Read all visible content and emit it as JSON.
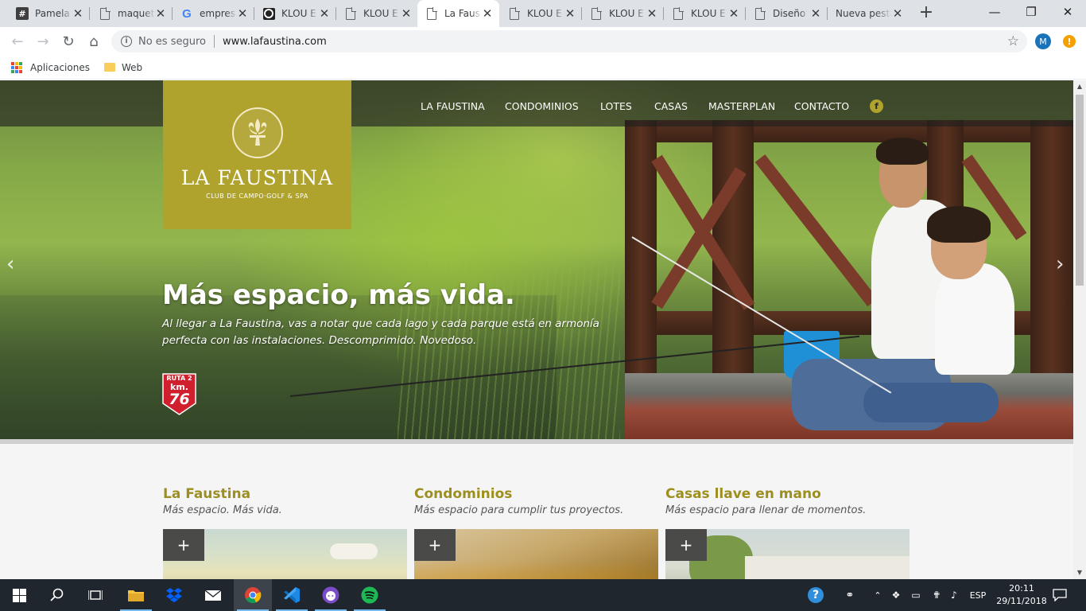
{
  "browser": {
    "tabs": [
      {
        "title": "Pamela",
        "icon": "hash-icon"
      },
      {
        "title": "maquet",
        "icon": "document-icon"
      },
      {
        "title": "empres",
        "icon": "google-icon"
      },
      {
        "title": "KLOU E",
        "icon": "klou-icon"
      },
      {
        "title": "KLOU E",
        "icon": "document-icon"
      },
      {
        "title": "La Faus",
        "icon": "document-icon",
        "active": true
      },
      {
        "title": "KLOU E",
        "icon": "document-icon"
      },
      {
        "title": "KLOU E",
        "icon": "document-icon"
      },
      {
        "title": "KLOU E",
        "icon": "document-icon"
      },
      {
        "title": "Diseño",
        "icon": "document-icon"
      },
      {
        "title": "Nueva pesta",
        "icon": "none"
      }
    ],
    "security_label": "No es seguro",
    "url": "www.lafaustina.com",
    "profile_initial": "M",
    "alert_glyph": "!",
    "bookmarks": [
      {
        "label": "Aplicaciones",
        "icon": "apps-icon"
      },
      {
        "label": "Web",
        "icon": "folder-icon"
      }
    ]
  },
  "site": {
    "logo": {
      "name": "LA FAUSTINA",
      "tagline": "CLUB DE CAMPO·GOLF & SPA"
    },
    "nav": [
      "LA FAUSTINA",
      "CONDOMINIOS",
      "LOTES",
      "CASAS",
      "MASTERPLAN",
      "CONTACTO"
    ],
    "facebook_glyph": "f",
    "hero": {
      "title": "Más espacio, más vida.",
      "text": "Al llegar a La Faustina, vas a notar que cada lago y cada parque está en armonía perfecta con las instalaciones. Descomprimido. Novedoso.",
      "badge_top": "RUTA 2",
      "badge_mid": "km.",
      "badge_num": "76"
    },
    "cards": [
      {
        "title": "La Faustina",
        "subtitle": "Más espacio. Más vida."
      },
      {
        "title": "Condominios",
        "subtitle": "Más espacio para cumplir tus proyectos."
      },
      {
        "title": "Casas llave en mano",
        "subtitle": "Más espacio para llenar de momentos."
      }
    ],
    "plus_glyph": "+"
  },
  "colors": {
    "brand_olive": "#afa22d",
    "card_title": "#9c8f1f"
  },
  "taskbar": {
    "language": "ESP",
    "time": "20:11",
    "date": "29/11/2018"
  }
}
